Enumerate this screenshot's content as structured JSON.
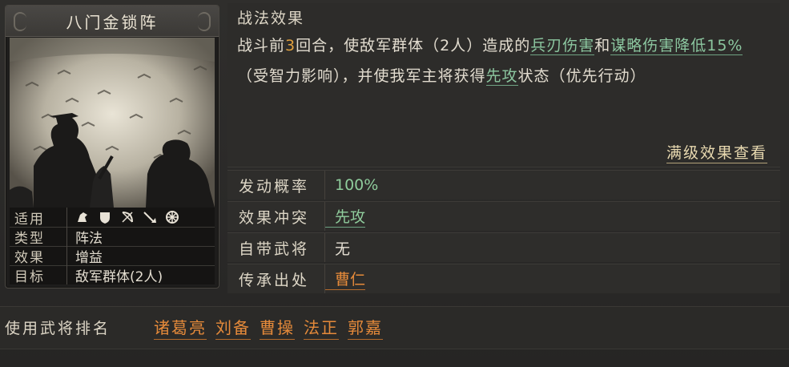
{
  "card": {
    "title": "八门金锁阵",
    "attrs": [
      {
        "key": "适用",
        "icons": [
          "cavalry-icon",
          "shield-icon",
          "bow-icon",
          "spear-icon",
          "wheel-icon"
        ]
      },
      {
        "key": "类型",
        "value": "阵法"
      },
      {
        "key": "效果",
        "value": "增益"
      },
      {
        "key": "目标",
        "value": "敌军群体(2人)"
      }
    ]
  },
  "effect": {
    "title": "战法效果",
    "text_parts": {
      "p1": "战斗前",
      "p2": "3",
      "p3": "回合，使敌军群体（2人）造成的",
      "p4": "兵刃伤害",
      "p5": "和",
      "p6": "谋略伤害降低",
      "p7": "15%",
      "p8": "（受智力影响），并使我军主将获得",
      "p9": "先攻",
      "p10": "状态（优先行动）"
    },
    "full_effect_link": "满级效果查看"
  },
  "props": [
    {
      "key": "发动概率",
      "value": "100%"
    },
    {
      "key": "效果冲突",
      "value": "先攻"
    },
    {
      "key": "自带武将",
      "value": "无"
    },
    {
      "key": "传承出处",
      "value": "曹仁"
    }
  ],
  "ranking": {
    "label": "使用武将排名",
    "names": [
      "诸葛亮",
      "刘备",
      "曹操",
      "法正",
      "郭嘉"
    ]
  },
  "colors": {
    "highlight_green": "#8cc7a0",
    "highlight_orange": "#e58a3a",
    "number_orange": "#e0a03e"
  }
}
